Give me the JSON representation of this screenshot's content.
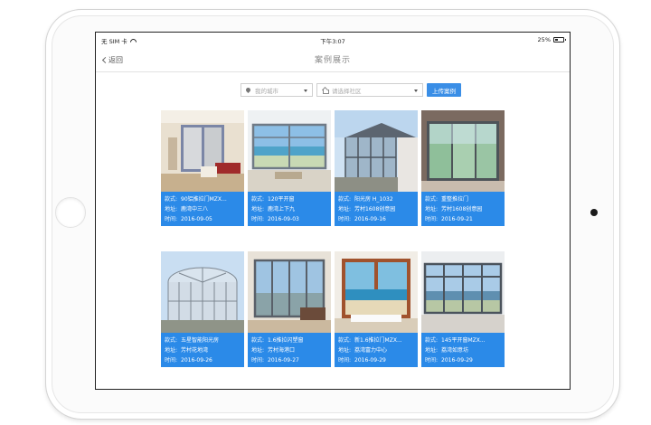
{
  "status_bar": {
    "carrier": "无 SIM 卡",
    "time": "下午3:07",
    "battery": "25%"
  },
  "nav": {
    "back_label": "返回",
    "title": "案例展示"
  },
  "filters": {
    "location_placeholder": "我的城市",
    "community_placeholder": "请选择社区",
    "upload_label": "上传案例"
  },
  "field_labels": {
    "style": "款式:",
    "address": "地址:",
    "time": "时间:"
  },
  "cases": [
    {
      "style": "90铝推拉门MZX...",
      "address": "鹿湾中三八",
      "date": "2016-09-05"
    },
    {
      "style": "120平开窗",
      "address": "鹿湾上下九",
      "date": "2016-09-03"
    },
    {
      "style": "阳光房 H_1032",
      "address": "芳村1608创意园",
      "date": "2016-09-16"
    },
    {
      "style": "重整推拉门",
      "address": "芳村1608创意园",
      "date": "2016-09-21"
    },
    {
      "style": "五星智能阳光房",
      "address": "芳村花地湾",
      "date": "2016-09-26"
    },
    {
      "style": "1.6推拉闪塑窗",
      "address": "芳村海港口",
      "date": "2016-09-27"
    },
    {
      "style": "新1.6推拉门MZX...",
      "address": "荔湾富力中心",
      "date": "2016-09-29"
    },
    {
      "style": "145平开窗MZX...",
      "address": "荔湾如意坊",
      "date": "2016-09-29"
    }
  ]
}
